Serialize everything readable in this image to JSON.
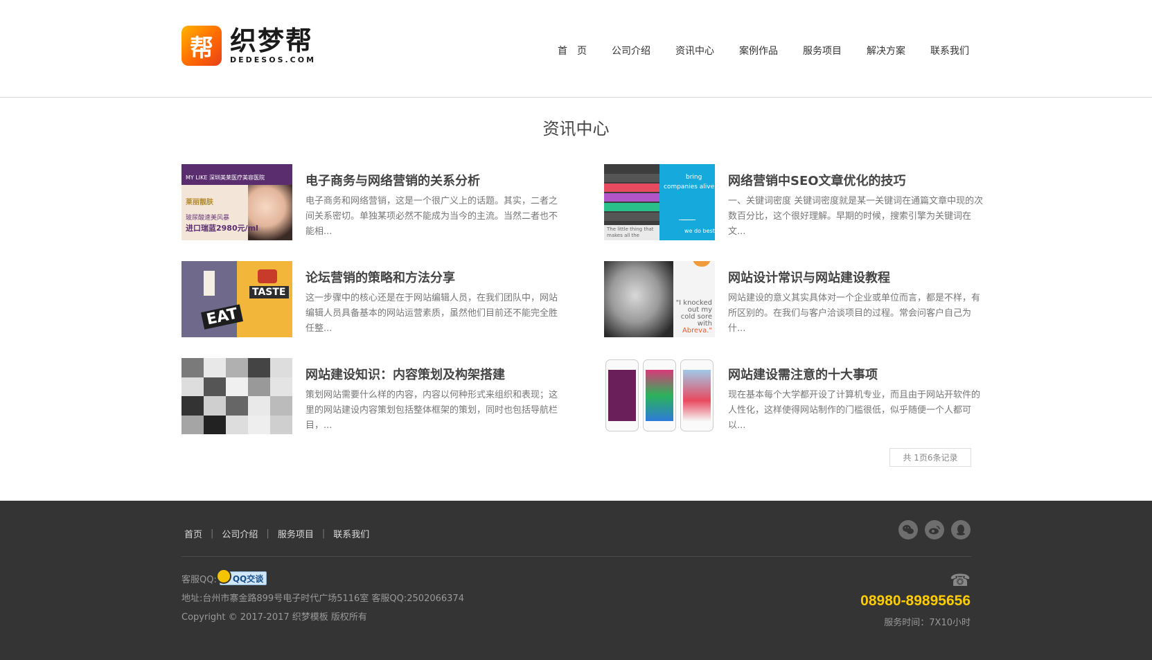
{
  "logo": {
    "mark": "帮",
    "cn": "织梦帮",
    "en": "DEDESOS.COM"
  },
  "nav": [
    "首　页",
    "公司介绍",
    "资讯中心",
    "案例作品",
    "服务项目",
    "解决方案",
    "联系我们"
  ],
  "page_title": "资讯中心",
  "articles": [
    {
      "title": "电子商务与网络营销的关系分析",
      "desc": "电子商务和网络营销，这是一个很广义上的话题。其实，二者之间关系密切。单独某项必然不能成为当今的主流。当然二者也不能相...",
      "thumb_text": [
        "MY LIKE 深圳美莱医疗美容医院",
        "莱丽靓肤",
        "玻尿酸速美风暴",
        "进口瑞蓝2980元/ml"
      ]
    },
    {
      "title": "网络营销中SEO文章优化的技巧",
      "desc": "一、关键词密度 关键词密度就是某一关键词在通篇文章中现的次数百分比，这个很好理解。早期的时候，搜索引擎为关键词在文...",
      "thumb_text": [
        "bring",
        "companies alive",
        "The little thing that makes all the",
        "we do best"
      ]
    },
    {
      "title": "论坛营销的策略和方法分享",
      "desc": "这一步骤中的核心还是在于网站编辑人员，在我们团队中，网站编辑人员具备基本的网站运营素质，虽然他们目前还不能完全胜任整...",
      "thumb_text": [
        "TASTE",
        "EAT"
      ]
    },
    {
      "title": "网站设计常识与网站建设教程",
      "desc": "网站建设的意义其实具体对一个企业或单位而言，都是不样，有所区别的。在我们与客户洽谈项目的过程。常会问客户自己为什...",
      "thumb_text": [
        "\"I knocked",
        "out my",
        "cold sore",
        "with",
        "Abreva.\""
      ]
    },
    {
      "title": "网站建设知识：内容策划及构架搭建",
      "desc": "策划网站需要什么样的内容，内容以何种形式来组织和表现；这里的网站建设内容策划包括整体框架的策划，同时也包括导航栏目，...",
      "thumb_text": []
    },
    {
      "title": "网站建设需注意的十大事项",
      "desc": "现在基本每个大学都开设了计算机专业，而且由于网站开软件的人性化，这样使得网站制作的门槛很低，似乎随便一个人都可以...",
      "thumb_text": []
    }
  ],
  "pager": "共 1页6条记录",
  "footer": {
    "links": [
      "首页",
      "公司介绍",
      "服务项目",
      "联系我们"
    ],
    "social_icons": [
      "wechat-icon",
      "weibo-icon",
      "qq-icon"
    ],
    "qq_label": "客服QQ:",
    "qq_badge": "QQ交谈",
    "address": "地址:台州市寨金路899号电子时代广场5116室 客服QQ:2502066374",
    "copyright": "Copyright © 2017-2017 织梦模板 版权所有",
    "phone": "08980-89895656",
    "hours": "服务时间：7X10小时"
  },
  "colors": {
    "accent": "#ffcc00",
    "footer_bg": "#343434",
    "logo_orange": "#ff6a00"
  }
}
